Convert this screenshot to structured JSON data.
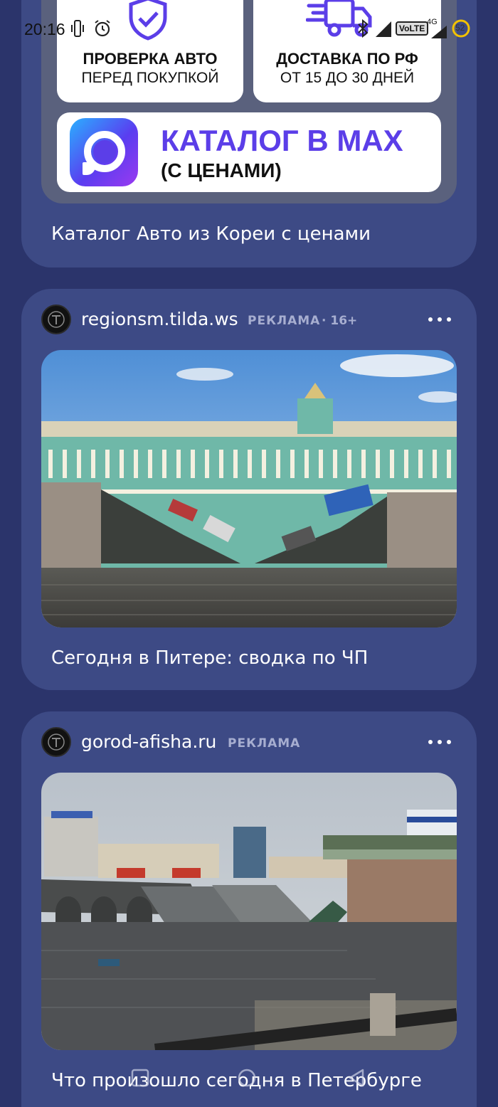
{
  "status_bar": {
    "time": "20:16",
    "network_label": "4G",
    "volte_label": "VoLTE",
    "battery_level": "52"
  },
  "feed": {
    "promo_card": {
      "tile_check": {
        "line1": "ПРОВЕРКА АВТО",
        "line2": "ПЕРЕД ПОКУПКОЙ",
        "icon": "shield-check-icon"
      },
      "tile_delivery": {
        "line1": "ДОСТАВКА ПО РФ",
        "line2": "ОТ 15 ДО 30 ДНЕЙ",
        "icon": "delivery-truck-icon"
      },
      "tile_max": {
        "title": "КАТАЛОГ В MAX",
        "subtitle": "(С ЦЕНАМИ)",
        "icon": "max-messenger-logo"
      },
      "title": "Каталог Авто из Кореи с ценами"
    },
    "ad_cards": [
      {
        "source": "regionsm.tilda.ws",
        "ad_label": "РЕКЛАМА",
        "age_label": "· 16+",
        "image": "collapsed-bridge-by-palace-photo",
        "title": "Сегодня в Питере: сводка по ЧП"
      },
      {
        "source": "gorod-afisha.ru",
        "ad_label": "РЕКЛАМА",
        "image": "collapsed-bridge-city-photo",
        "title": "Что произошло сегодня в Петербурге"
      }
    ]
  },
  "colors": {
    "background": "#2b346b",
    "card": "#3d4a85",
    "accent_max": "#5b3ee8",
    "ad_label": "#a7aed0"
  }
}
